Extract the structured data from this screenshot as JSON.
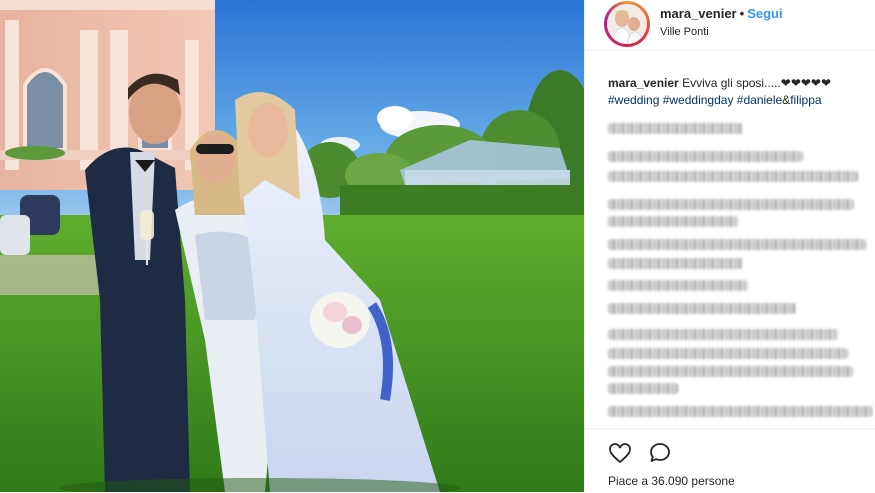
{
  "post": {
    "username": "mara_venier",
    "separator": "•",
    "follow_label": "Segui",
    "location": "Ville Ponti"
  },
  "caption": {
    "username": "mara_venier",
    "text": "Evviva gli sposi.....",
    "hearts": "❤❤❤❤❤",
    "hashtag_1": "#wedding",
    "hashtag_2": "#weddingday",
    "hashtag_3": "#daniele",
    "amp": "&",
    "hashtag_4": "filippa"
  },
  "actions": {
    "like_icon": "heart-outline-icon",
    "comment_icon": "speech-bubble-icon"
  },
  "likes": {
    "label": "Piace a 36.090 persone"
  },
  "colors": {
    "follow": "#3897f0",
    "hashtag": "#003569",
    "text": "#262626",
    "border": "#efefef"
  }
}
